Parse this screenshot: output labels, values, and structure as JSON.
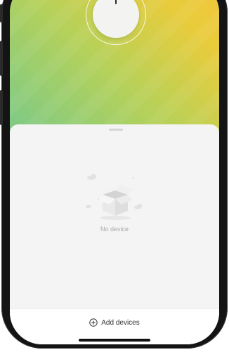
{
  "app": {
    "empty_state": {
      "text": "No device",
      "icon": "empty-box-icon"
    },
    "footer": {
      "add_label": "Add devices",
      "add_icon": "plus-circle-icon"
    }
  },
  "colors": {
    "gradient": [
      "#78c98a",
      "#b4d15b",
      "#f2c63a"
    ],
    "sheet": "#f4f4f4",
    "text_muted": "#a8a8a8",
    "text_main": "#333333"
  }
}
